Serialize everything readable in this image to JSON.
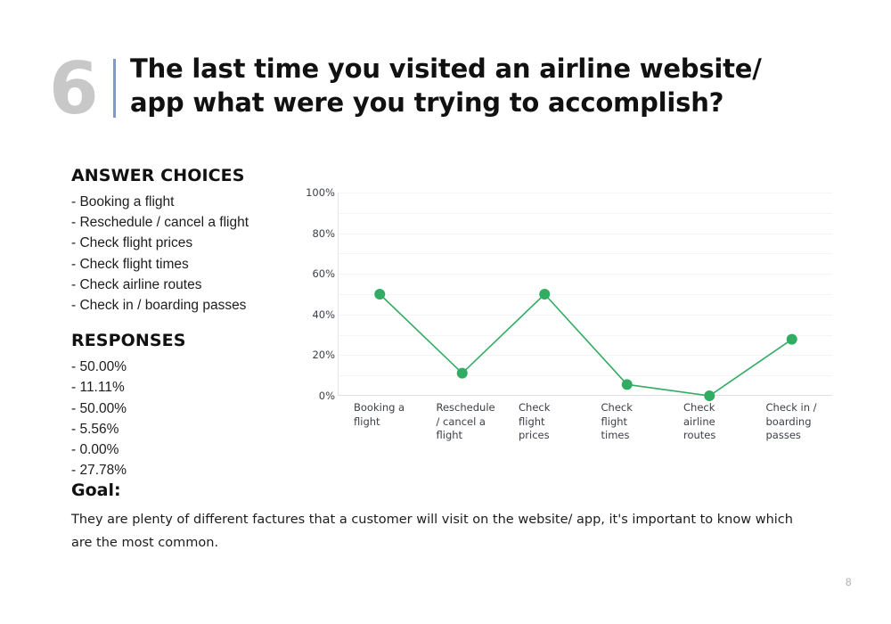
{
  "slide": {
    "number": "6",
    "title": "The last time you visited an airline website/ app what were you trying to accomplish?",
    "page_number": "8",
    "accent_color": "#7f99cc",
    "series_color": "#33ac63"
  },
  "answer_choices": {
    "heading": "ANSWER CHOICES",
    "items": [
      "- Booking a flight",
      "- Reschedule / cancel a flight",
      "- Check flight prices",
      "- Check flight times",
      "- Check airline routes",
      "- Check in / boarding passes"
    ]
  },
  "responses": {
    "heading": "RESPONSES",
    "items": [
      "- 50.00%",
      "- 11.11%",
      "- 50.00%",
      "- 5.56%",
      "- 0.00%",
      "- 27.78%"
    ]
  },
  "goal": {
    "heading": "Goal:",
    "text": "They are plenty of different factures that a customer will visit on the website/ app, it's important to know which are the most common."
  },
  "chart_data": {
    "type": "line",
    "title": "",
    "xlabel": "",
    "ylabel": "",
    "categories": [
      "Booking a flight",
      "Reschedule / cancel a flight",
      "Check flight prices",
      "Check flight times",
      "Check airline routes",
      "Check in / boarding passes"
    ],
    "category_label_lines": [
      [
        "Booking a",
        "flight"
      ],
      [
        "Reschedule",
        "/ cancel a",
        "flight"
      ],
      [
        "Check",
        "flight",
        "prices"
      ],
      [
        "Check",
        "flight",
        "times"
      ],
      [
        "Check",
        "airline",
        "routes"
      ],
      [
        "Check in /",
        "boarding",
        "passes"
      ]
    ],
    "values": [
      50.0,
      11.11,
      50.0,
      5.56,
      0.0,
      27.78
    ],
    "series": [
      {
        "name": "Responses",
        "values": [
          50.0,
          11.11,
          50.0,
          5.56,
          0.0,
          27.78
        ],
        "color": "#33ac63"
      }
    ],
    "ylim": [
      0,
      100
    ],
    "yticks": [
      0,
      20,
      40,
      60,
      80,
      100
    ],
    "ytick_labels": [
      "0%",
      "20%",
      "40%",
      "60%",
      "80%",
      "100%"
    ],
    "minor_gridline_step": 10,
    "grid": true,
    "legend": false,
    "marker": "circle",
    "marker_radius": 6
  }
}
